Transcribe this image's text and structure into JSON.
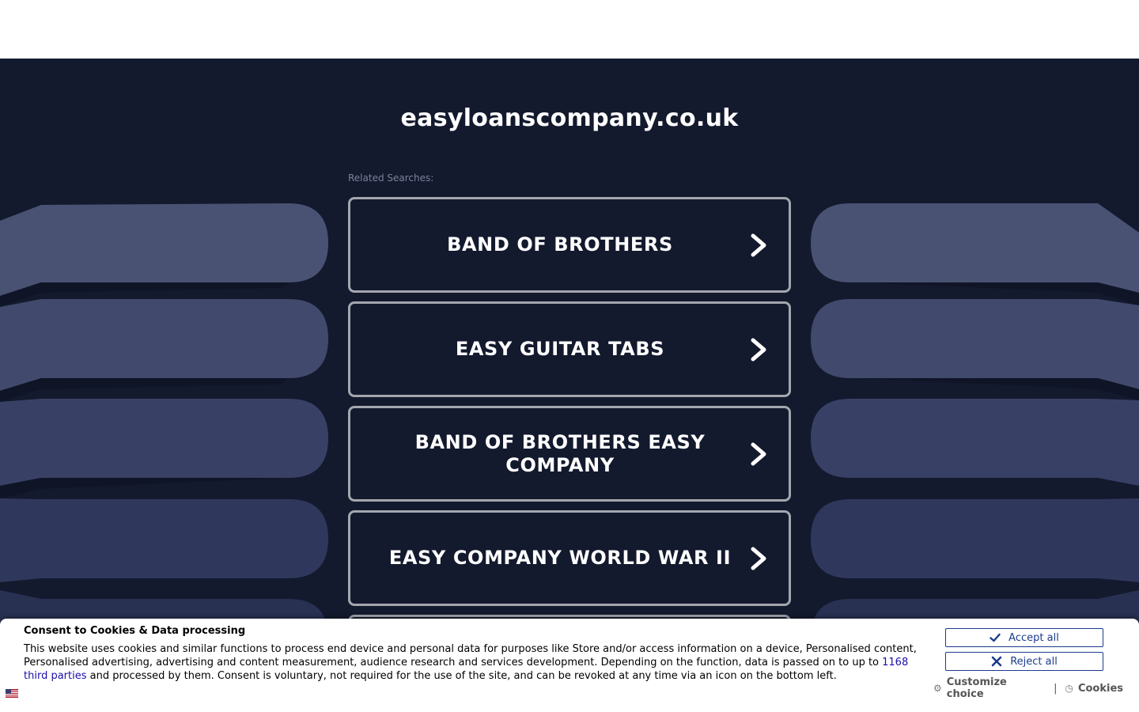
{
  "page": {
    "domain": "easyloanscompany.co.uk",
    "related_label": "Related Searches:",
    "searches": [
      {
        "label": "BAND OF BROTHERS"
      },
      {
        "label": "EASY GUITAR TABS"
      },
      {
        "label": "BAND OF BROTHERS EASY COMPANY"
      },
      {
        "label": "EASY COMPANY WORLD WAR II"
      }
    ],
    "chevron_icon": "chevron-right-icon"
  },
  "consent": {
    "title": "Consent to Cookies & Data processing",
    "text_before_link": "This website uses cookies and similar functions to process end device and personal data for purposes like Store and/or access information on a device, Personalised content, Personalised advertising, advertising and content measurement, audience research and services development. Depending on the function, data is passed on to up to ",
    "link_text": "1168 third parties",
    "text_after_link": " and processed by them. Consent is voluntary, not required for the use of the site, and can be revoked at any time via an icon on the bottom left.",
    "accept_label": "Accept all",
    "reject_label": "Reject all",
    "customize_label": "Customize choice",
    "separator": "|",
    "cookies_label": "Cookies",
    "flag_icon": "us-flag-icon"
  },
  "colors": {
    "background": "#131a2e",
    "button_border": "#a3a7ae",
    "consent_accent": "#1b3b8c",
    "link": "#1a0dab"
  }
}
